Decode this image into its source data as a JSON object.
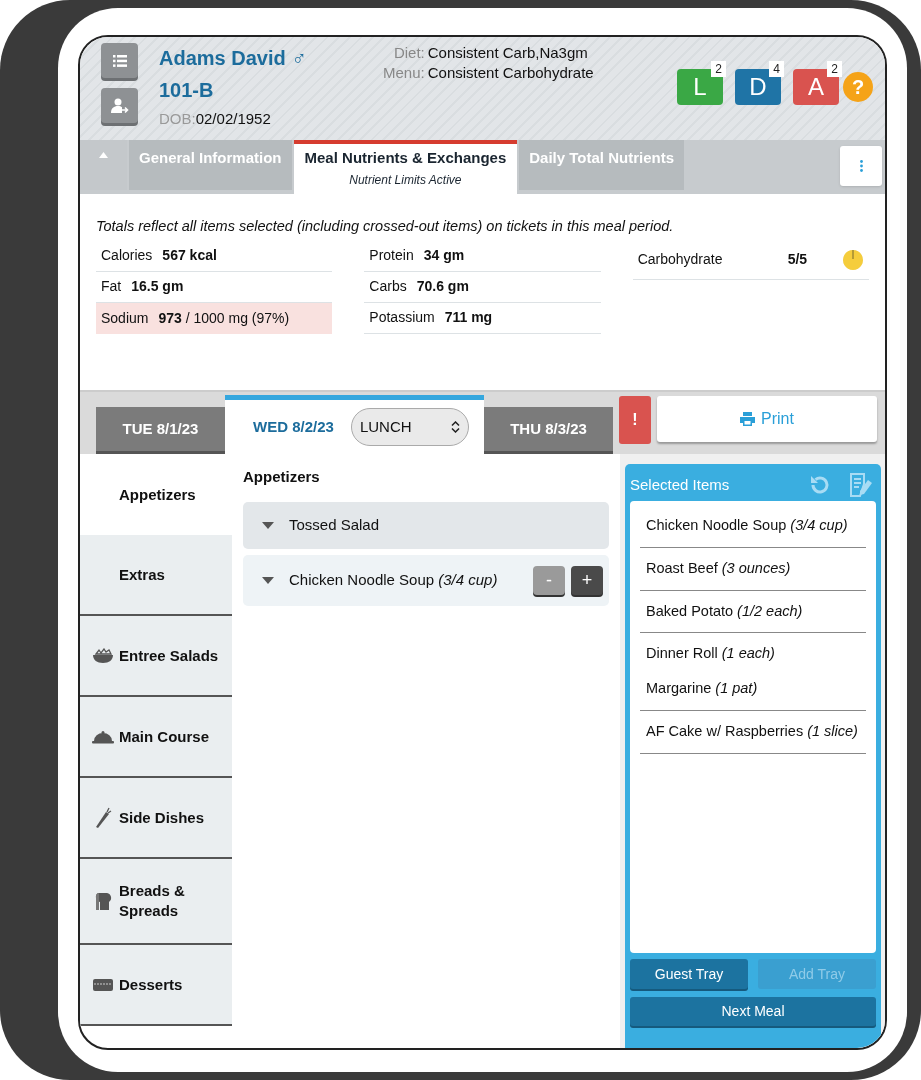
{
  "patient": {
    "name": "Adams David",
    "gender_symbol": "♂",
    "room": "101-B",
    "dob_label": "DOB:",
    "dob": "02/02/1952"
  },
  "diet": [
    {
      "label": "Diet:",
      "value": "Consistent Carb,Na3gm"
    },
    {
      "label": "Menu:",
      "value": "Consistent Carbohydrate"
    }
  ],
  "meal_badges": [
    {
      "letter": "L",
      "count": "2",
      "color": "#3aa845"
    },
    {
      "letter": "D",
      "count": "4",
      "color": "#1f74a6"
    },
    {
      "letter": "A",
      "count": "2",
      "color": "#d9534f"
    }
  ],
  "help": "?",
  "tabs": [
    {
      "title": "General Information",
      "selected": false
    },
    {
      "title": "Meal Nutrients & Exchanges",
      "subtitle": "Nutrient Limits Active",
      "selected": true
    },
    {
      "title": "Daily Total Nutrients",
      "selected": false
    }
  ],
  "nutrients_note": "Totals reflect all items selected (including crossed-out items) on tickets in this meal period.",
  "nutrient_columns": [
    [
      {
        "label": "Calories",
        "value": "567 kcal",
        "kind": "total",
        "alert": false
      },
      {
        "label": "Fat",
        "value": "16.5 gm",
        "kind": "total",
        "alert": false
      },
      {
        "label": "Sodium",
        "value": "**973** / 1000 mg (97%)",
        "kind": "limit",
        "alert": true
      }
    ],
    [
      {
        "label": "Protein",
        "value": "34 gm",
        "kind": "total",
        "alert": false
      },
      {
        "label": "Carbs",
        "value": "70.6 gm",
        "kind": "total",
        "alert": false
      },
      {
        "label": "Potassium",
        "value": "711 mg",
        "kind": "total",
        "alert": false
      }
    ]
  ],
  "exchanges": [
    {
      "label": "Carbohydrate",
      "value": "5/5",
      "level": 1
    }
  ],
  "dates": [
    {
      "label": "TUE 8/1/23",
      "selected": false
    },
    {
      "label": "WED 8/2/23",
      "selected": true
    },
    {
      "label": "THU 8/3/23",
      "selected": false
    }
  ],
  "meal_select": "LUNCH",
  "alert_button": "!",
  "print_button": "Print",
  "categories": [
    {
      "label": "Appetizers",
      "selected": true
    },
    {
      "label": "Extras",
      "selected": false
    },
    {
      "label": "Entree Salads",
      "selected": false
    },
    {
      "label": "Main Course",
      "selected": false
    },
    {
      "label": "Side Dishes",
      "selected": false
    },
    {
      "label": "Breads & Spreads",
      "selected": false
    },
    {
      "label": "Desserts",
      "selected": false
    }
  ],
  "section_title": "Appetizers",
  "menu_items": [
    {
      "name": "Tossed Salad",
      "selected": false
    },
    {
      "name": "Chicken Noodle Soup *(3/4 cup)*",
      "selected": true,
      "buttons": [
        {
          "label": "-",
          "disabled": true
        },
        {
          "label": "+",
          "disabled": false
        }
      ]
    }
  ],
  "selected_panel": {
    "title": "Selected Items",
    "groups": [
      {
        "items": [
          "Chicken Noodle Soup *(3/4 cup)*"
        ]
      },
      {
        "items": [
          "Roast Beef *(3 ounces)*"
        ]
      },
      {
        "items": [
          "Baked Potato *(1/2 each)*"
        ]
      },
      {
        "items": [
          "Dinner Roll *(1 each)*",
          "Margarine *(1 pat)*"
        ]
      },
      {
        "items": [
          "AF Cake w/ Raspberries *(1 slice)*"
        ]
      }
    ],
    "buttons": [
      {
        "label": "Guest Tray",
        "disabled": false
      },
      {
        "label": "Add Tray",
        "disabled": true
      }
    ],
    "next_button": "Next Meal"
  }
}
